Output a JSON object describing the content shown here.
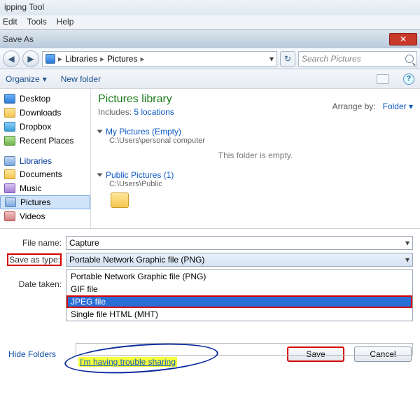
{
  "app": {
    "title": "ipping Tool",
    "menu": {
      "edit": "Edit",
      "tools": "Tools",
      "help": "Help"
    }
  },
  "dialog": {
    "title": "Save As",
    "close_glyph": "✕",
    "nav": {
      "back_glyph": "◀",
      "fwd_glyph": "▶",
      "crumb_libraries": "Libraries",
      "crumb_pictures": "Pictures",
      "sep": "▸",
      "refresh_glyph": "↻",
      "search_placeholder": "Search Pictures"
    },
    "toolbar": {
      "organize": "Organize",
      "newfolder": "New folder",
      "help_glyph": "?"
    },
    "sidebar": {
      "desktop": "Desktop",
      "downloads": "Downloads",
      "dropbox": "Dropbox",
      "recent": "Recent Places",
      "libraries": "Libraries",
      "documents": "Documents",
      "music": "Music",
      "pictures": "Pictures",
      "videos": "Videos"
    },
    "main": {
      "heading": "Pictures library",
      "includes_label": "Includes:",
      "includes_link": "5 locations",
      "arrange_label": "Arrange by:",
      "arrange_value": "Folder ▾",
      "group1_title": "My Pictures (Empty)",
      "group1_path": "C:\\Users\\personal computer",
      "empty_msg": "This folder is empty.",
      "group2_title": "Public Pictures (1)",
      "group2_path": "C:\\Users\\Public"
    },
    "form": {
      "filename_label": "File name:",
      "filename_value": "Capture",
      "saveastype_label": "Save as type:",
      "saveastype_value": "Portable Network Graphic file (PNG)",
      "date_label": "Date taken:",
      "caret": "▾",
      "options": {
        "png": "Portable Network Graphic file (PNG)",
        "gif": "GIF file",
        "jpeg": "JPEG file",
        "mht": "Single file HTML (MHT)"
      }
    },
    "buttons": {
      "hide": "Hide Folders",
      "save": "Save",
      "cancel": "Cancel"
    }
  },
  "annotation": {
    "link": "I'm having trouble sharing"
  }
}
